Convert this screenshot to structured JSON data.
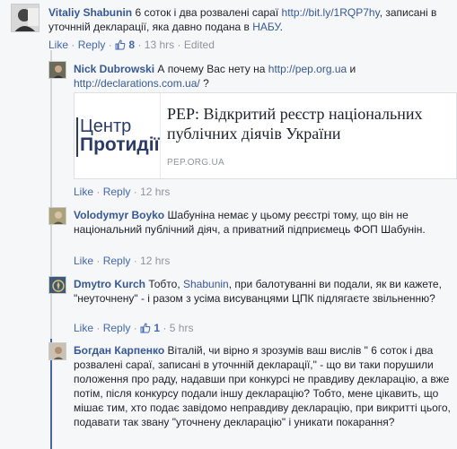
{
  "comments": [
    {
      "author": "Vitaliy Shabunin",
      "text1": " 6 соток і два розвалені сараї ",
      "link1": "http://bit.ly/1RQP7hy",
      "text2": ", записані в уточнній декларації, яка давно подана в ",
      "link2": "НАБУ",
      "text3": ".",
      "like": "Like",
      "reply": "Reply",
      "likes": "8",
      "time": "13 hrs",
      "edited": "Edited",
      "sep": "·"
    },
    {
      "author": "Nick Dubrowski",
      "text1": " А почему Вас нету на ",
      "link1": "http://pep.org.ua",
      "text2": " и ",
      "link2": "http://declarations.com.ua/",
      "text3": " ?",
      "like": "Like",
      "reply": "Reply",
      "time": "12 hrs",
      "sep": "·"
    },
    {
      "author": "Volodymyr Boyko",
      "text1": " Шабуніна немає у цьому реєстрі тому, що він не національний публічний діяч, а приватний підприємець ФОП Шабунін.",
      "like": "Like",
      "reply": "Reply",
      "time": "12 hrs",
      "sep": "·"
    },
    {
      "author": "Dmytro Kurch",
      "text1": " Тобто, ",
      "mention": "Shabunin",
      "text2": ", при балотуванні ви подали, як ви кажете, \"неуточнену\" - і разом з усіма висуванцями ЦПК підлягаєте звільненню?",
      "like": "Like",
      "reply": "Reply",
      "likes": "1",
      "time": "5 hrs",
      "sep": "·"
    },
    {
      "author": "Богдан Карпенко",
      "text1": " Віталій, чи вірно я зрозумів ваш вислів \" 6 соток і два розвалені сараї, записані в уточнній декларації,\" - що ви таки порушили положення про раду, надавши при конкурсі не правдиву декларацію, а вже потім, після конкурсу подали іншу декларацію? Тобто, мене цікавить, що мішає тим, хто подає завідомо неправдиву декларацію, при викритті цього, подавати так звану \"уточнену декларацію\" і уникати покарання?"
    }
  ],
  "card": {
    "title": "PEP: Відкритий реєстр національних публічних діячів України",
    "domain": "PEP.ORG.UA",
    "logo_line1": "Центр",
    "logo_line2": "Протидії"
  },
  "colors": {
    "link": "#365899",
    "meta": "#90949c",
    "thread_active": "#4267b2"
  }
}
